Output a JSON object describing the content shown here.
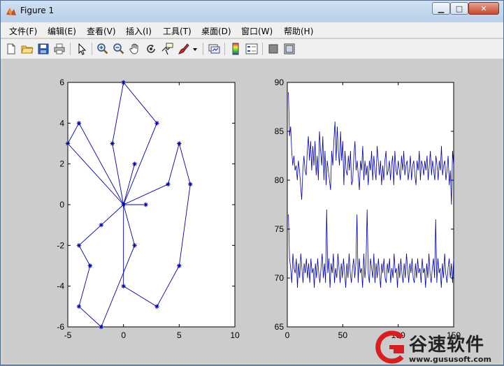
{
  "window": {
    "title": "Figure 1",
    "controls": {
      "minimize": "▁",
      "maximize": "□",
      "close": "✕"
    }
  },
  "menubar": {
    "items": [
      "文件(F)",
      "编辑(E)",
      "查看(V)",
      "插入(I)",
      "工具(T)",
      "桌面(D)",
      "窗口(W)",
      "帮助(H)"
    ],
    "dock_arrow": "↘"
  },
  "toolbar": {
    "icons": [
      "new-figure-icon",
      "open-file-icon",
      "save-icon",
      "print-icon",
      "edit-plot-arrow-icon",
      "zoom-in-icon",
      "zoom-out-icon",
      "pan-hand-icon",
      "rotate-3d-icon",
      "data-cursor-icon",
      "brush-icon",
      "brush-dropdown-icon",
      "link-plot-icon",
      "colorbar-icon",
      "legend-icon",
      "hide-plot-tools-icon",
      "show-plot-tools-icon"
    ]
  },
  "chart_data": [
    {
      "type": "line",
      "marker": "asterisk",
      "color": "#0000aa",
      "xlim": [
        -5,
        10
      ],
      "ylim": [
        -6,
        6
      ],
      "xticks": [
        -5,
        0,
        5,
        10
      ],
      "yticks": [
        -6,
        -4,
        -2,
        0,
        2,
        4,
        6
      ],
      "edges": [
        [
          [
            0,
            6
          ],
          [
            3,
            4
          ]
        ],
        [
          [
            3,
            4
          ],
          [
            0,
            0
          ]
        ],
        [
          [
            0,
            6
          ],
          [
            -1,
            3
          ]
        ],
        [
          [
            -1,
            3
          ],
          [
            0,
            0
          ]
        ],
        [
          [
            -4,
            4
          ],
          [
            -5,
            3
          ]
        ],
        [
          [
            -4,
            4
          ],
          [
            0,
            0
          ]
        ],
        [
          [
            -5,
            3
          ],
          [
            0,
            0
          ]
        ],
        [
          [
            1,
            2
          ],
          [
            0,
            0
          ]
        ],
        [
          [
            5,
            3
          ],
          [
            6,
            1
          ]
        ],
        [
          [
            5,
            3
          ],
          [
            4,
            1
          ]
        ],
        [
          [
            4,
            1
          ],
          [
            0,
            0
          ]
        ],
        [
          [
            6,
            1
          ],
          [
            5,
            -3
          ]
        ],
        [
          [
            5,
            -3
          ],
          [
            3,
            -5
          ]
        ],
        [
          [
            3,
            -5
          ],
          [
            0,
            -4
          ]
        ],
        [
          [
            0,
            -4
          ],
          [
            0,
            0
          ]
        ],
        [
          [
            2,
            0
          ],
          [
            0,
            0
          ]
        ],
        [
          [
            -2,
            -1
          ],
          [
            0,
            0
          ]
        ],
        [
          [
            -2,
            -1
          ],
          [
            -4,
            -2
          ]
        ],
        [
          [
            -4,
            -2
          ],
          [
            -3,
            -3
          ]
        ],
        [
          [
            -3,
            -3
          ],
          [
            -4,
            -5
          ]
        ],
        [
          [
            1,
            -2
          ],
          [
            0,
            0
          ]
        ],
        [
          [
            1,
            -2
          ],
          [
            -2,
            -6
          ]
        ],
        [
          [
            -4,
            -5
          ],
          [
            -2,
            -6
          ]
        ]
      ],
      "points": [
        [
          0,
          6
        ],
        [
          3,
          4
        ],
        [
          -4,
          4
        ],
        [
          -5,
          3
        ],
        [
          -1,
          3
        ],
        [
          5,
          3
        ],
        [
          1,
          2
        ],
        [
          4,
          1
        ],
        [
          6,
          1
        ],
        [
          0,
          0
        ],
        [
          2,
          0
        ],
        [
          -2,
          -1
        ],
        [
          -4,
          -2
        ],
        [
          1,
          -2
        ],
        [
          -3,
          -3
        ],
        [
          5,
          -3
        ],
        [
          0,
          -4
        ],
        [
          -4,
          -5
        ],
        [
          3,
          -5
        ],
        [
          -2,
          -6
        ]
      ]
    },
    {
      "type": "line",
      "color": "#0000aa",
      "xlim": [
        0,
        150
      ],
      "ylim": [
        65,
        90
      ],
      "xticks": [
        0,
        50,
        100,
        150
      ],
      "yticks": [
        65,
        70,
        75,
        80,
        85,
        90
      ],
      "series": [
        {
          "values": [
            89.0,
            84.5,
            85.5,
            83.0,
            81.5,
            82.5,
            81.0,
            81.5,
            80.0,
            82.0,
            81.0,
            79.5,
            78.0,
            81.0,
            82.5,
            81.0,
            80.5,
            83.0,
            84.5,
            82.0,
            84.0,
            81.0,
            83.5,
            81.5,
            84.0,
            80.5,
            82.5,
            80.0,
            85.0,
            83.0,
            81.5,
            84.5,
            80.0,
            83.0,
            79.5,
            82.0,
            81.0,
            80.0,
            79.0,
            83.0,
            81.5,
            84.0,
            86.0,
            82.0,
            85.5,
            83.0,
            81.5,
            85.0,
            82.0,
            84.0,
            79.5,
            83.0,
            81.0,
            80.5,
            82.5,
            81.0,
            83.0,
            79.5,
            80.0,
            82.5,
            84.0,
            81.0,
            82.0,
            80.5,
            79.0,
            82.0,
            81.0,
            83.5,
            80.0,
            82.0,
            80.5,
            81.5,
            79.5,
            82.0,
            81.0,
            83.0,
            80.0,
            82.5,
            81.0,
            80.0,
            83.5,
            82.0,
            80.5,
            82.0,
            79.5,
            81.5,
            80.0,
            82.0,
            83.0,
            80.5,
            81.0,
            82.0,
            80.0,
            81.5,
            82.5,
            79.5,
            83.0,
            81.0,
            80.5,
            82.0,
            81.0,
            80.0,
            82.5,
            81.0,
            83.0,
            80.5,
            81.5,
            82.0,
            80.0,
            81.0,
            82.5,
            80.0,
            81.5,
            82.0,
            80.5,
            79.5,
            82.0,
            81.0,
            83.0,
            80.0,
            82.0,
            81.5,
            80.5,
            82.0,
            81.0,
            82.5,
            80.0,
            81.5,
            83.0,
            80.5,
            82.0,
            81.0,
            80.0,
            82.5,
            81.5,
            80.0,
            82.0,
            81.0,
            83.5,
            80.5,
            81.5,
            82.0,
            80.0,
            81.0,
            82.5,
            79.5,
            81.0,
            77.5,
            83.0,
            81.5
          ]
        },
        {
          "values": [
            76.5,
            72.0,
            71.0,
            69.5,
            72.5,
            71.0,
            70.5,
            72.0,
            69.0,
            71.5,
            70.0,
            72.5,
            71.0,
            69.5,
            71.5,
            70.5,
            72.0,
            70.0,
            71.5,
            69.5,
            72.0,
            70.5,
            71.0,
            69.0,
            71.5,
            70.0,
            72.0,
            70.5,
            69.5,
            71.0,
            72.5,
            70.0,
            71.5,
            69.5,
            77.0,
            70.5,
            72.0,
            69.0,
            71.5,
            70.5,
            72.5,
            69.5,
            71.0,
            70.0,
            72.5,
            71.0,
            69.5,
            71.5,
            70.0,
            72.0,
            70.5,
            69.0,
            71.5,
            70.0,
            72.5,
            70.5,
            69.5,
            71.0,
            72.0,
            70.0,
            71.5,
            76.5,
            69.5,
            72.0,
            70.5,
            71.0,
            69.0,
            72.5,
            70.0,
            71.5,
            77.0,
            70.5,
            69.5,
            72.0,
            71.0,
            70.0,
            72.5,
            69.5,
            71.5,
            70.0,
            72.0,
            70.5,
            69.0,
            71.5,
            70.5,
            72.0,
            70.0,
            69.5,
            71.5,
            70.5,
            72.0,
            69.5,
            71.0,
            70.0,
            72.5,
            70.5,
            71.0,
            69.0,
            71.5,
            70.0,
            72.0,
            70.5,
            69.5,
            71.5,
            70.0,
            72.5,
            71.0,
            69.5,
            71.5,
            70.5,
            72.0,
            70.0,
            69.5,
            71.5,
            70.0,
            72.0,
            70.5,
            71.0,
            69.5,
            72.0,
            70.5,
            71.0,
            69.0,
            71.5,
            70.0,
            72.5,
            70.5,
            69.5,
            71.0,
            72.0,
            70.0,
            76.0,
            69.5,
            72.0,
            70.5,
            71.0,
            69.0,
            71.5,
            70.0,
            72.5,
            70.5,
            69.5,
            71.0,
            72.0,
            70.0,
            71.5,
            69.5,
            72.0
          ]
        }
      ]
    }
  ],
  "watermark": {
    "cn_text": "谷速软件",
    "url": "www.gususoft.com",
    "logo": "gususoft-logo"
  }
}
